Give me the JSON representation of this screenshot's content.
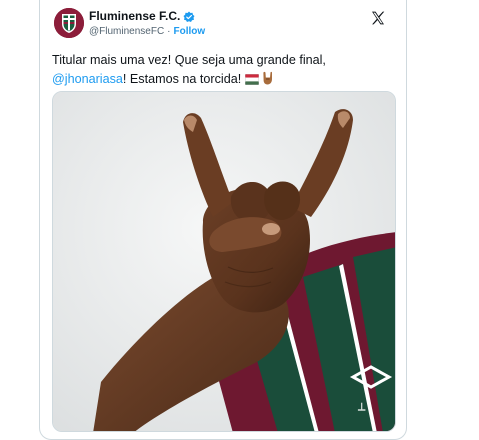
{
  "account": {
    "display_name": "Fluminense F.C.",
    "handle": "@FluminenseFC",
    "separator": "·",
    "follow_label": "Follow",
    "verified_color": "#1d9bf0"
  },
  "tweet": {
    "line1": "Titular mais uma vez! Que seja uma grande final,",
    "mention": "@jhonariasa",
    "line2_rest": "! Estamos na torcida!",
    "emojis": [
      "hungary-flag-icon",
      "sign-of-the-horns-icon"
    ]
  },
  "media": {
    "subject": "rock-hand-gesture-photo",
    "jersey_colors": [
      "#7b1a33",
      "#1a4d3a",
      "#ffffff"
    ]
  },
  "colors": {
    "text": "#0f1419",
    "secondary": "#536471",
    "link": "#1d9bf0",
    "border": "#cfd9de"
  }
}
